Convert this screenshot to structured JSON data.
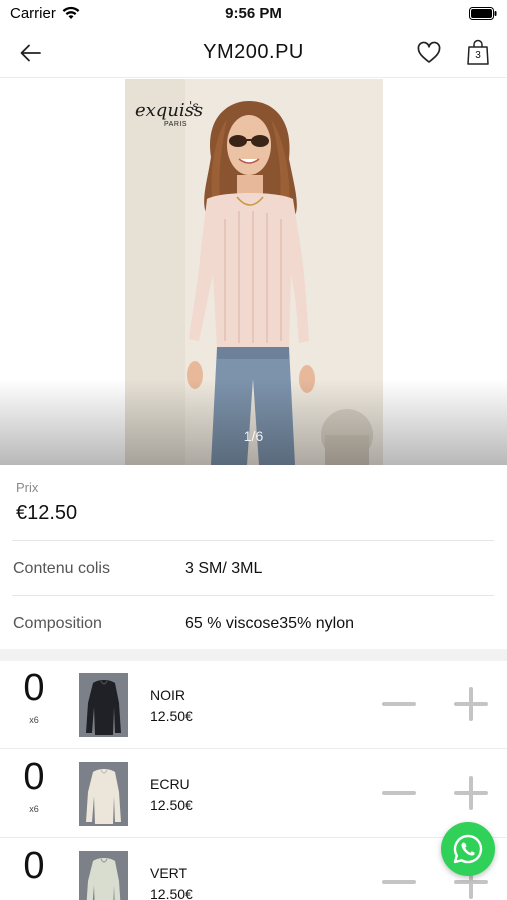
{
  "status_bar": {
    "carrier": "Carrier",
    "time": "9:56 PM"
  },
  "nav": {
    "title": "YM200.PU",
    "cart_count": "3",
    "back_icon": "arrow-left-icon",
    "favorite_icon": "heart-icon",
    "cart_icon": "shopping-bag-icon"
  },
  "gallery": {
    "brand": "exquiss's",
    "brand_city": "PARIS",
    "page_indicator": "1/6"
  },
  "product": {
    "price_label": "Prix",
    "price": "€12.50",
    "info": [
      {
        "label": "Contenu colis",
        "value": "3 SM/ 3ML"
      },
      {
        "label": "Composition",
        "value": "65 % viscose35% nylon"
      }
    ]
  },
  "variants": [
    {
      "quantity": "0",
      "multiplier": "x6",
      "color": "NOIR",
      "price": "12.50€",
      "swatch": "#1f2126"
    },
    {
      "quantity": "0",
      "multiplier": "x6",
      "color": "ECRU",
      "price": "12.50€",
      "swatch": "#ece6da"
    },
    {
      "quantity": "0",
      "multiplier": "",
      "color": "VERT",
      "price": "12.50€",
      "swatch": "#d9ddd0"
    }
  ],
  "whatsapp": {
    "icon": "whatsapp-icon",
    "color": "#2fd158"
  }
}
